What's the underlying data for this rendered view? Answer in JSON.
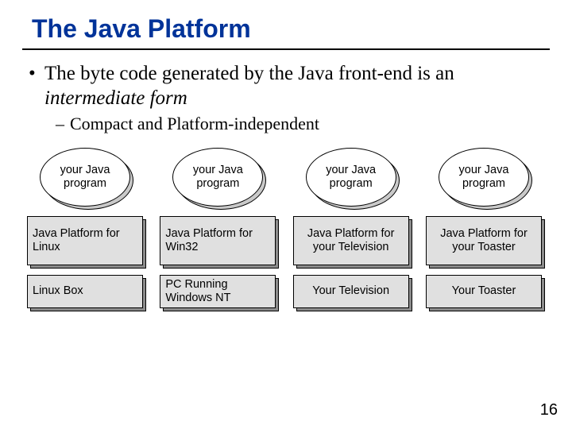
{
  "title": "The Java Platform",
  "bullet1_pre": "The byte code generated by the Java front-end is an ",
  "bullet1_ital": "intermediate form",
  "bullet2": "Compact and Platform-independent",
  "columns": [
    {
      "oval": "your Java program",
      "platform": "Java Platform for Linux",
      "platform_align": "left",
      "hw": "Linux Box",
      "hw_align": "left"
    },
    {
      "oval": "your Java program",
      "platform": "Java Platform for Win32",
      "platform_align": "left",
      "hw": "PC Running Windows NT",
      "hw_align": "left"
    },
    {
      "oval": "your Java program",
      "platform": "Java Platform for your Television",
      "platform_align": "center",
      "hw": "Your Television",
      "hw_align": "center"
    },
    {
      "oval": "your Java program",
      "platform": "Java Platform for your Toaster",
      "platform_align": "center",
      "hw": "Your Toaster",
      "hw_align": "center"
    }
  ],
  "page_number": "16"
}
